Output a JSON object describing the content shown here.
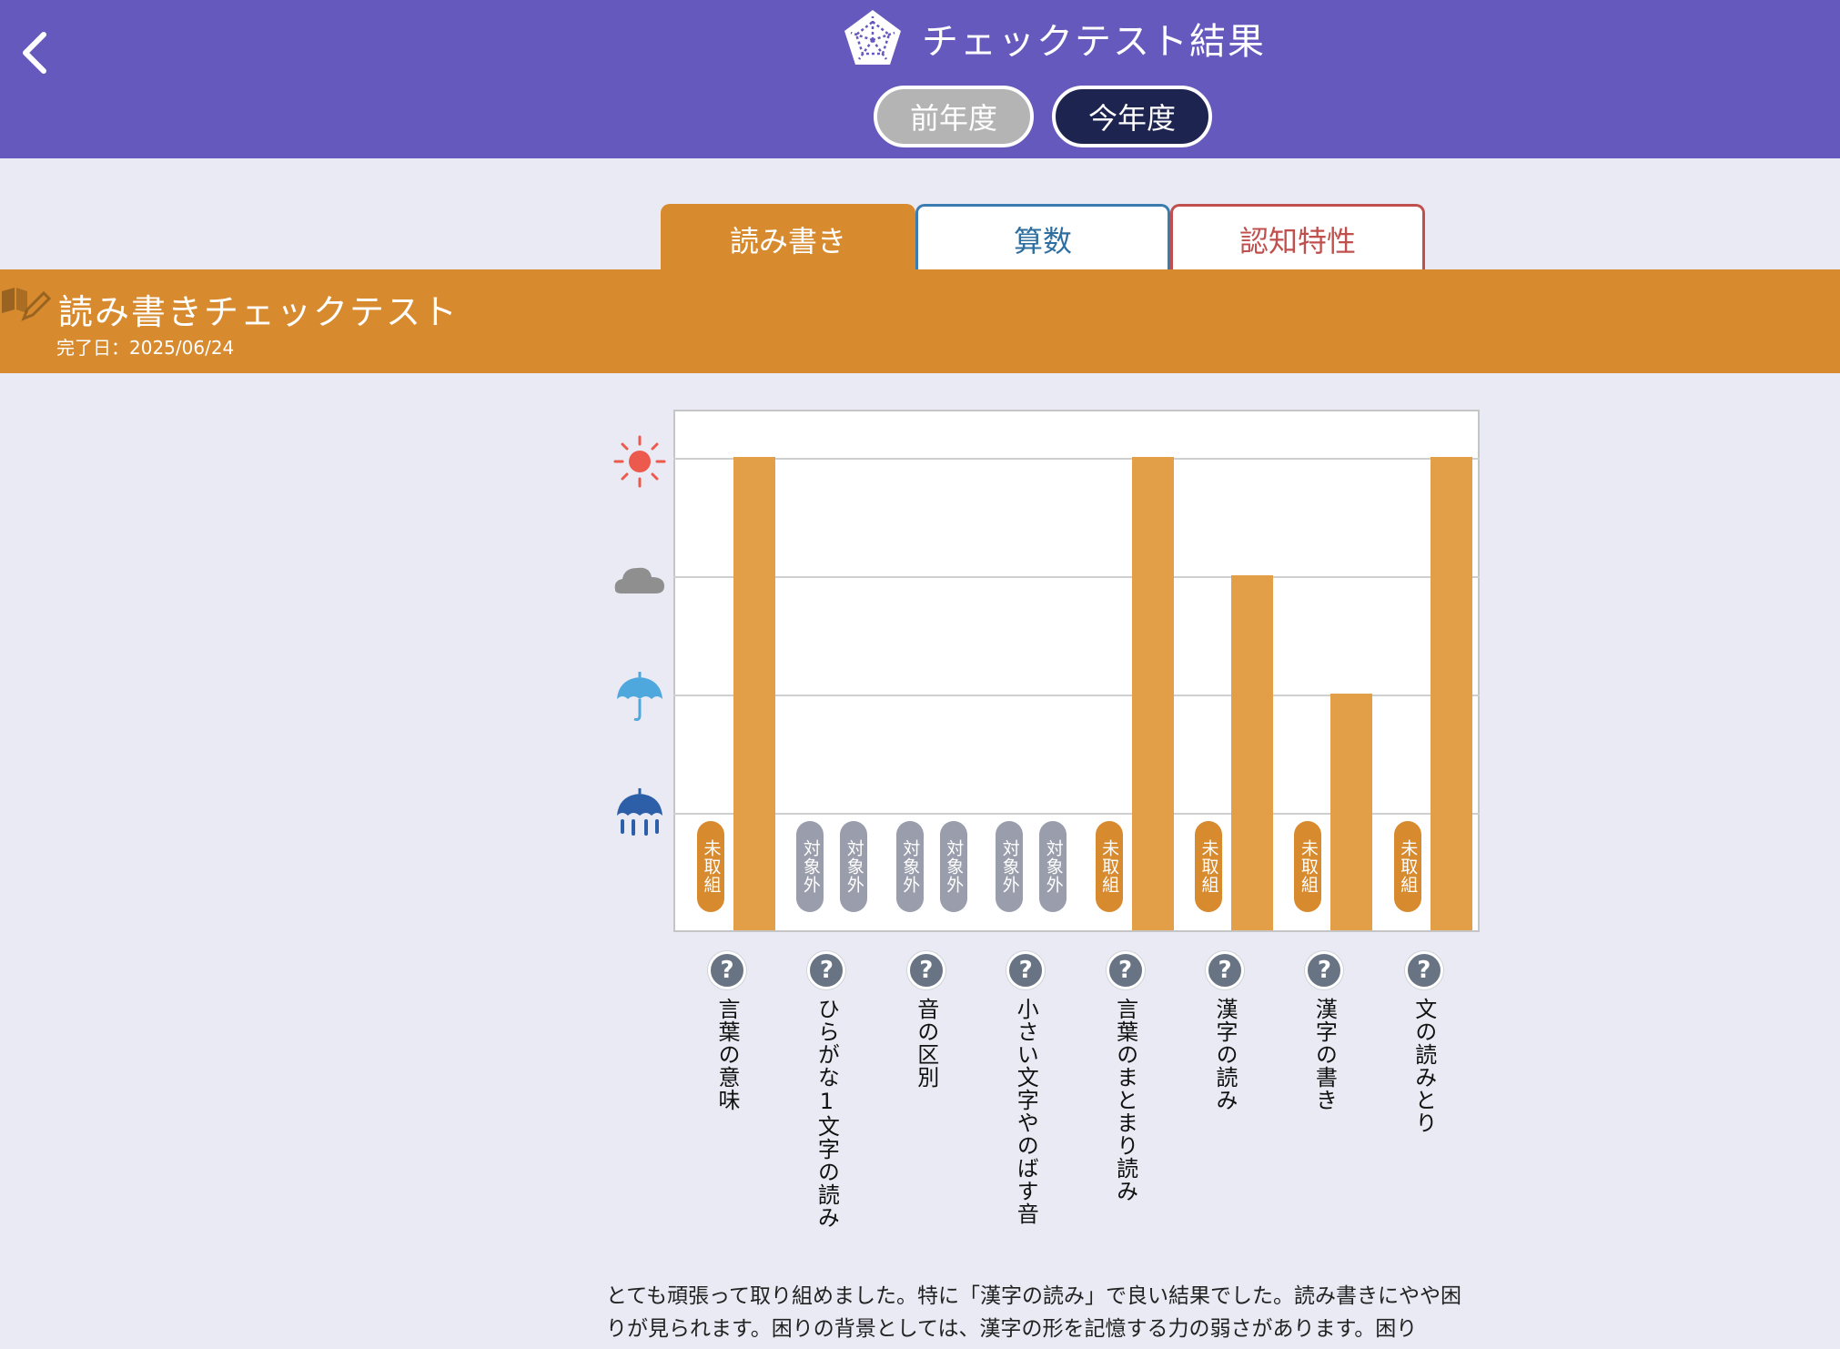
{
  "header": {
    "title": "チェックテスト結果",
    "back_icon": "chevron-left-icon",
    "logo_icon": "pentagon-star-icon",
    "year_buttons": {
      "previous": "前年度",
      "current": "今年度"
    }
  },
  "tabs": [
    {
      "label": "読み書き",
      "active": true,
      "color": "#d78a2e"
    },
    {
      "label": "算数",
      "active": false,
      "color": "#3a7bb0"
    },
    {
      "label": "認知特性",
      "active": false,
      "color": "#c0504d"
    }
  ],
  "section": {
    "title": "読み書きチェックテスト",
    "completed": "完了日：2025/06/24",
    "icon": "book-pencil-icon"
  },
  "chart_data": {
    "type": "bar",
    "y_levels": [
      "heavy-rain-icon",
      "umbrella-icon",
      "cloud-icon",
      "sun-icon"
    ],
    "ylim": [
      0,
      4
    ],
    "grid": true,
    "categories": [
      "言葉の意味",
      "ひらがな1文字の読み",
      "音の区別",
      "小さい文字やのばす音",
      "言葉のまとまり読み",
      "漢字の読み",
      "漢字の書き",
      "文の読みとり"
    ],
    "series": [
      {
        "values": [
          4,
          null,
          null,
          null,
          4,
          3,
          2,
          4
        ]
      }
    ],
    "pills": [
      [
        "未取組"
      ],
      [
        "対象外",
        "対象外"
      ],
      [
        "対象外",
        "対象外"
      ],
      [
        "対象外",
        "対象外"
      ],
      [
        "未取組"
      ],
      [
        "未取組"
      ],
      [
        "未取組"
      ],
      [
        "未取組"
      ]
    ],
    "help_icon": "question-circle-icon",
    "bar_color": "#e39f48"
  },
  "comment": "とても頑張って取り組めました。特に「漢字の読み」で良い結果でした。読み書きにやや困りが見られます。困りの背景としては、漢字の形を記憶する力の弱さがあります。困り"
}
